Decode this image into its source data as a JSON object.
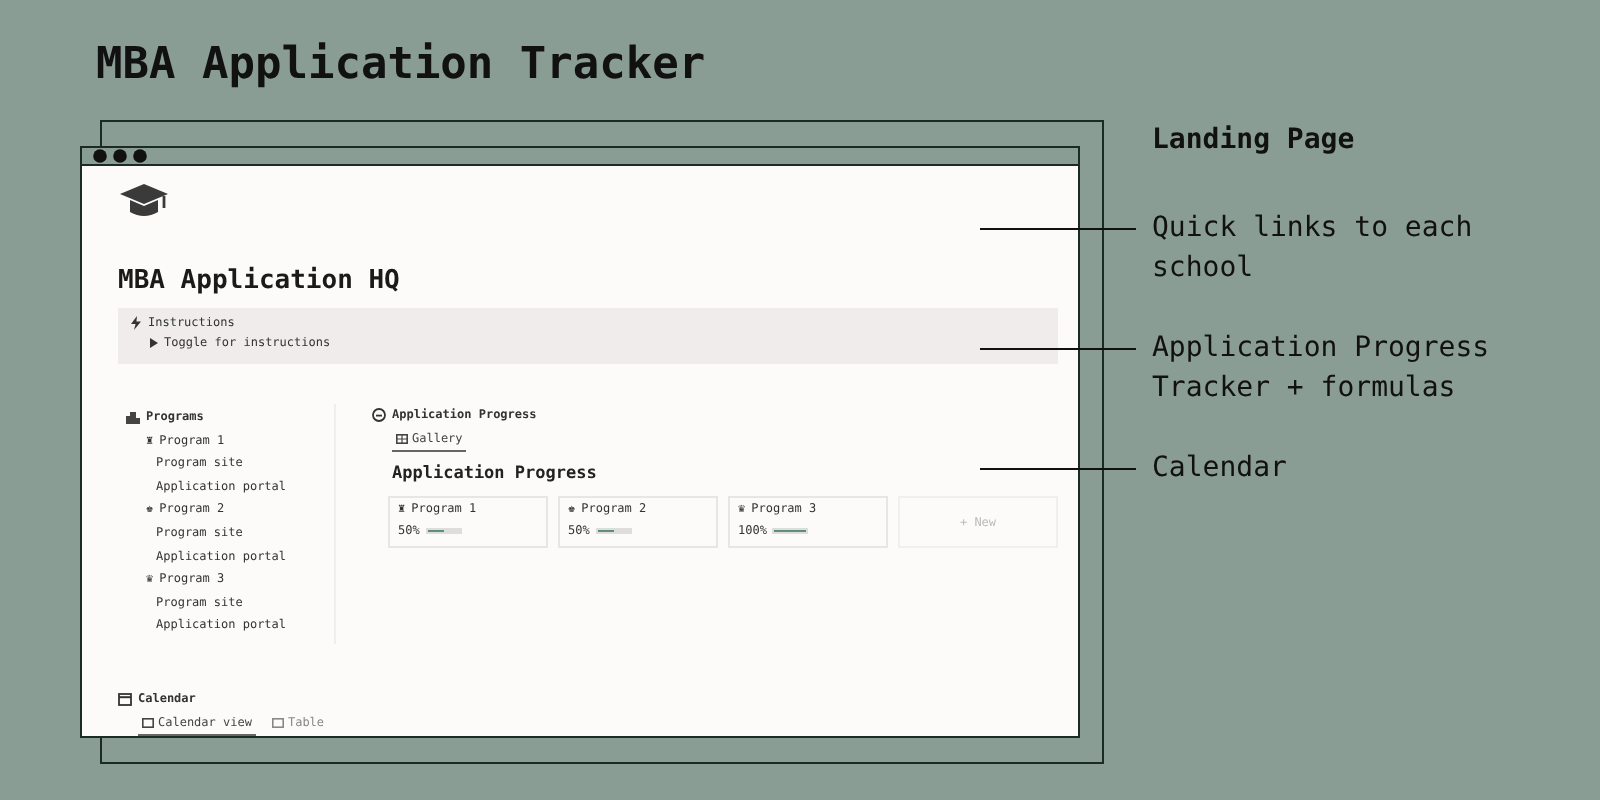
{
  "title": "MBA Application Tracker",
  "window": {
    "page_title": "MBA Application HQ",
    "callout": {
      "title": "Instructions",
      "toggle": "Toggle for instructions"
    },
    "programs": {
      "title": "Programs",
      "items": [
        {
          "icon": "♜",
          "name": "Program 1",
          "links": [
            "Program site",
            "Application portal"
          ]
        },
        {
          "icon": "♚",
          "name": "Program 2",
          "links": [
            "Program site",
            "Application portal"
          ]
        },
        {
          "icon": "♛",
          "name": "Program 3",
          "links": [
            "Program site",
            "Application portal"
          ]
        }
      ]
    },
    "progress": {
      "title": "Application Progress",
      "tabs": [
        {
          "label": "Gallery",
          "selected": true
        }
      ],
      "heading": "Application Progress",
      "cards": [
        {
          "icon": "♜",
          "name": "Program 1",
          "reading": "50%",
          "level": 0.5
        },
        {
          "icon": "♚",
          "name": "Program 2",
          "reading": "50%",
          "level": 0.5
        },
        {
          "icon": "♛",
          "name": "Program 3",
          "reading": "100%",
          "level": 1.0
        }
      ],
      "new_label": "+ New"
    },
    "calendar": {
      "title": "Calendar",
      "tabs": [
        {
          "label": "Calendar view",
          "selected": true
        },
        {
          "label": "Table",
          "selected": false
        }
      ]
    }
  },
  "annotations": [
    {
      "text": "Landing Page",
      "kind": "heading"
    },
    {
      "text": "Quick links to each school",
      "kind": "note"
    },
    {
      "text": "Application Progress Tracker + formulas",
      "kind": "note"
    },
    {
      "text": "Calendar",
      "kind": "note"
    }
  ]
}
